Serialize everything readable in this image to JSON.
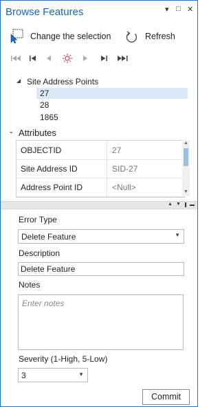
{
  "window": {
    "title": "Browse Features",
    "menu_glyph": "▾",
    "restore_glyph": "□",
    "close_glyph": "✕"
  },
  "toolbar": {
    "change_selection_label": "Change the selection",
    "refresh_label": "Refresh"
  },
  "nav_buttons": [
    "first",
    "previous-group",
    "previous",
    "flash",
    "next",
    "next-group",
    "last"
  ],
  "tree": {
    "layer_name": "Site Address Points",
    "items": [
      "27",
      "28",
      "1865"
    ],
    "selected_item": "27"
  },
  "attributes": {
    "header": "Attributes",
    "rows": [
      {
        "field": "OBJECTID",
        "value": "27"
      },
      {
        "field": "Site Address ID",
        "value": "SID-27"
      },
      {
        "field": "Address Point ID",
        "value": "<Null>"
      }
    ]
  },
  "form": {
    "error_type_label": "Error Type",
    "error_type_value": "Delete Feature",
    "description_label": "Description",
    "description_value": "Delete Feature",
    "notes_label": "Notes",
    "notes_placeholder": "Enter notes",
    "severity_label": "Severity (1-High, 5-Low)",
    "severity_value": "3",
    "commit_label": "Commit"
  },
  "colors": {
    "accent": "#1565c0",
    "selection": "#dce9f7",
    "border": "#2a6fb8"
  }
}
